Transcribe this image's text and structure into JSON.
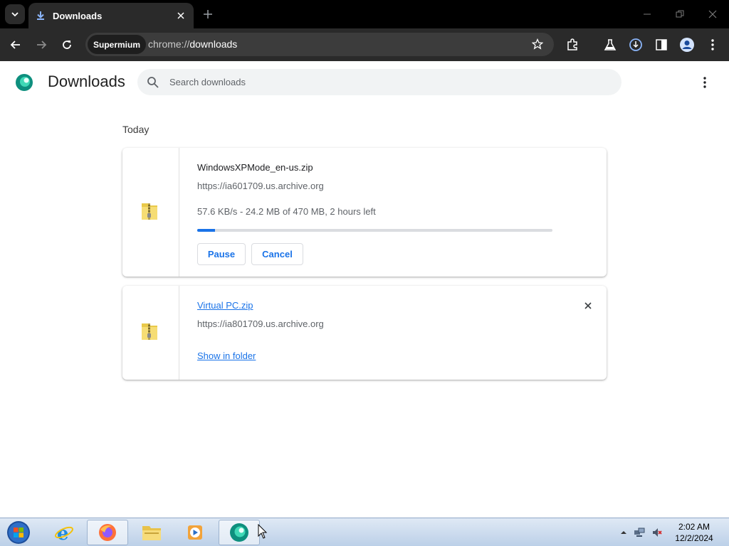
{
  "browser": {
    "tab_title": "Downloads",
    "chip_label": "Supermium",
    "url_scheme": "chrome://",
    "url_host": "downloads"
  },
  "page": {
    "title": "Downloads",
    "search_placeholder": "Search downloads",
    "section_label": "Today"
  },
  "downloads": [
    {
      "filename": "WindowsXPMode_en-us.zip",
      "source": "https://ia601709.us.archive.org",
      "status": "57.6 KB/s - 24.2 MB of 470 MB, 2 hours left",
      "progress": 0.05,
      "pause_label": "Pause",
      "cancel_label": "Cancel"
    },
    {
      "filename": "Virtual PC.zip",
      "source": "https://ia801709.us.archive.org",
      "show_in_folder_label": "Show in folder"
    }
  ],
  "taskbar": {
    "time": "2:02 AM",
    "date": "12/2/2024"
  },
  "colors": {
    "accent": "#1a73e8",
    "chrome_dark": "#2a2a2a",
    "tabstrip": "#000000"
  }
}
